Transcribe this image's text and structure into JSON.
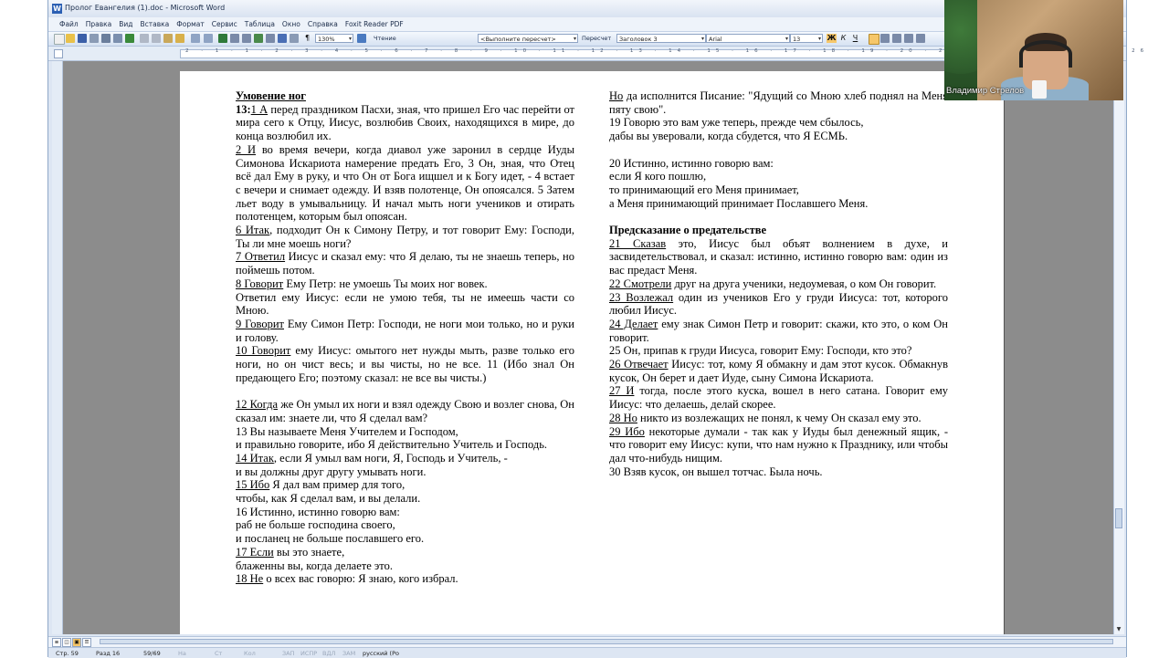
{
  "window": {
    "title": "Пролог Евангелия (1).doc - Microsoft Word",
    "app_icon": "W"
  },
  "menu": [
    "Файл",
    "Правка",
    "Вид",
    "Вставка",
    "Формат",
    "Сервис",
    "Таблица",
    "Окно",
    "Справка",
    "Foxit Reader PDF"
  ],
  "toolbar": {
    "zoom": "130%",
    "reading_label": "Чтение",
    "perform_box": "<Выполните пересчет>",
    "perform_button": "Пересчет",
    "style": "Заголовок 3",
    "font": "Arial",
    "size": "13",
    "bold_label": "Ж",
    "italic_label": "К",
    "underline_label": "Ч"
  },
  "ruler": {
    "ticks": "2 · 1 · 1 · 2 · 3 · 4 · 5 · 6 · 7 · 8 · 9 · 10 · 11 · 12 · 13 · 14 · 15 · 16 · 17 · 18 · 19 · 20 · 21 · 22 · 23 · 24 · 25 · 26"
  },
  "document": {
    "left_heading": "Умовение ног",
    "left": [
      {
        "bold": "13:",
        "num": "1 А",
        "text": " перед праздником Пасхи, зная, что пришел Его час перейти от мира сего к Отцу, Иисус, возлюбив Своих, находящихся в мире, до конца возлюбил их."
      },
      {
        "num": "2 И",
        "text": " во время вечери, когда диавол уже заронил в сердце Иуды Симонова Искариота намерение предать Его, 3 Он, зная, что Отец всё дал Ему в руку, и что Он от Бога ищшел и к Богу идет, - 4 встает с вечери и снимает одежду. И взяв полотенце, Он опоясался. 5 Затем льет воду в умывальницу. И начал мыть ноги учеников и отирать полотенцем, которым был опоясан."
      },
      {
        "num": "6 Итак",
        "text": ", подходит Он к Симону Петру, и тот говорит Ему: Господи, Ты ли мне моешь ноги?"
      },
      {
        "num": "7 Ответил",
        "text": " Иисус и сказал ему: что Я делаю, ты не знаешь теперь, но поймешь потом."
      },
      {
        "num": "8 Говорит",
        "text": " Ему Петр: не умоешь Ты моих ног вовек."
      },
      {
        "text": "Ответил ему Иисус: если не умою тебя, ты не имеешь части со Мною."
      },
      {
        "num": "9 Говорит",
        "text": " Ему Симон Петр: Господи, не ноги мои только, но и руки и голову."
      },
      {
        "num": "10 Говорит",
        "text": " ему Иисус: омытого нет нужды мыть, разве только его ноги, но он чист весь; и вы чисты, но не все. 11 (Ибо знал Он предающего Его; поэтому сказал: не все вы чисты.)"
      },
      {
        "blank": true
      },
      {
        "num": "12 Когда",
        "text": " же Он умыл их ноги и взял одежду Свою и возлег снова, Он сказал им: знаете ли, что Я сделал вам?"
      },
      {
        "text": "13 Вы называете Меня Учителем и Господом,"
      },
      {
        "text": "и правильно говорите, ибо Я действительно Учитель и Господь."
      },
      {
        "num": "14 Итак",
        "text": ", если Я умыл вам ноги, Я, Господь и Учитель, -"
      },
      {
        "text": "и вы должны друг другу умывать ноги."
      },
      {
        "num": "15 Ибо",
        "text": " Я дал вам пример для того,"
      },
      {
        "text": "чтобы, как Я сделал вам, и вы делали."
      },
      {
        "text": "16 Истинно, истинно говорю вам:"
      },
      {
        "text": "раб не больше господина своего,"
      },
      {
        "text": "и посланец не больше пославшего его."
      },
      {
        "num": "17 Если",
        "text": " вы это знаете,"
      },
      {
        "text": "блаженны вы, когда делаете это."
      },
      {
        "num": "18 Не",
        "text": " о всех вас говорю: Я знаю, кого избрал."
      }
    ],
    "right_top": [
      {
        "num": "Но",
        "text": " да исполнится Писание: \"Ядущий со Мною хлеб поднял на Меня пяту свою\"."
      },
      {
        "text": "19 Говорю это вам уже теперь, прежде чем сбылось,"
      },
      {
        "text": "дабы вы уверовали, когда сбудется, что Я ЕСМЬ."
      },
      {
        "blank": true
      },
      {
        "text": "20 Истинно, истинно говорю вам:"
      },
      {
        "text": "если Я кого пошлю,"
      },
      {
        "text": "то принимающий его Меня принимает,"
      },
      {
        "text": "а Меня принимающий принимает Пославшего Меня."
      },
      {
        "blank": true
      }
    ],
    "right_heading": "Предсказание о предательстве",
    "right_bottom": [
      {
        "num": "21 Сказав",
        "text": " это, Иисус был объят волнением в духе, и засвидетельствовал, и сказал: истинно, истинно говорю вам: один из вас предаст Меня."
      },
      {
        "num": "22 Смотрели",
        "text": " друг на друга ученики, недоумевая, о ком Он говорит."
      },
      {
        "num": "23 Возлежал",
        "text": " один из учеников Его у груди Иисуса: тот, которого любил Иисус."
      },
      {
        "num": "24 Делает",
        "text": " ему знак Симон Петр и говорит: скажи, кто это, о ком Он говорит."
      },
      {
        "text": "25 Он, припав к груди Иисуса, говорит Ему: Господи, кто это?"
      },
      {
        "num": "26 Отвечает",
        "text": " Иисус: тот, кому Я обмакну и дам этот кусок. Обмакнув кусок, Он берет и дает Иуде, сыну Симона Искариота."
      },
      {
        "num": "27 И",
        "text": " тогда, после этого куска, вошел в него сатана. Говорит ему Иисус: что делаешь, делай скорее."
      },
      {
        "num": "28 Но",
        "text": " никто из возлежащих не понял, к чему Он сказал ему это."
      },
      {
        "num": "29 Ибо",
        "text": " некоторые думали - так как у Иуды был денежный ящик, - что говорит ему Иисус: купи, что нам нужно к Празднику, или чтобы дал что-нибудь нищим."
      },
      {
        "text": "30 Взяв кусок, он вышел тотчас. Была ночь."
      }
    ]
  },
  "statusbar": {
    "page": "Стр. 59",
    "section": "Разд 16",
    "pages": "59/69",
    "at": "На",
    "line": "Ст",
    "col": "Кол",
    "rec": "ЗАП",
    "trk": "ИСПР",
    "ext": "ВДЛ",
    "ovr": "ЗАМ",
    "lang": "русский (Ро"
  },
  "video": {
    "participant_name": "Владимир Стрелов"
  },
  "colors": {
    "titlebar": "#d9e3f1",
    "workarea": "#8c8c8c",
    "page": "#ffffff"
  }
}
